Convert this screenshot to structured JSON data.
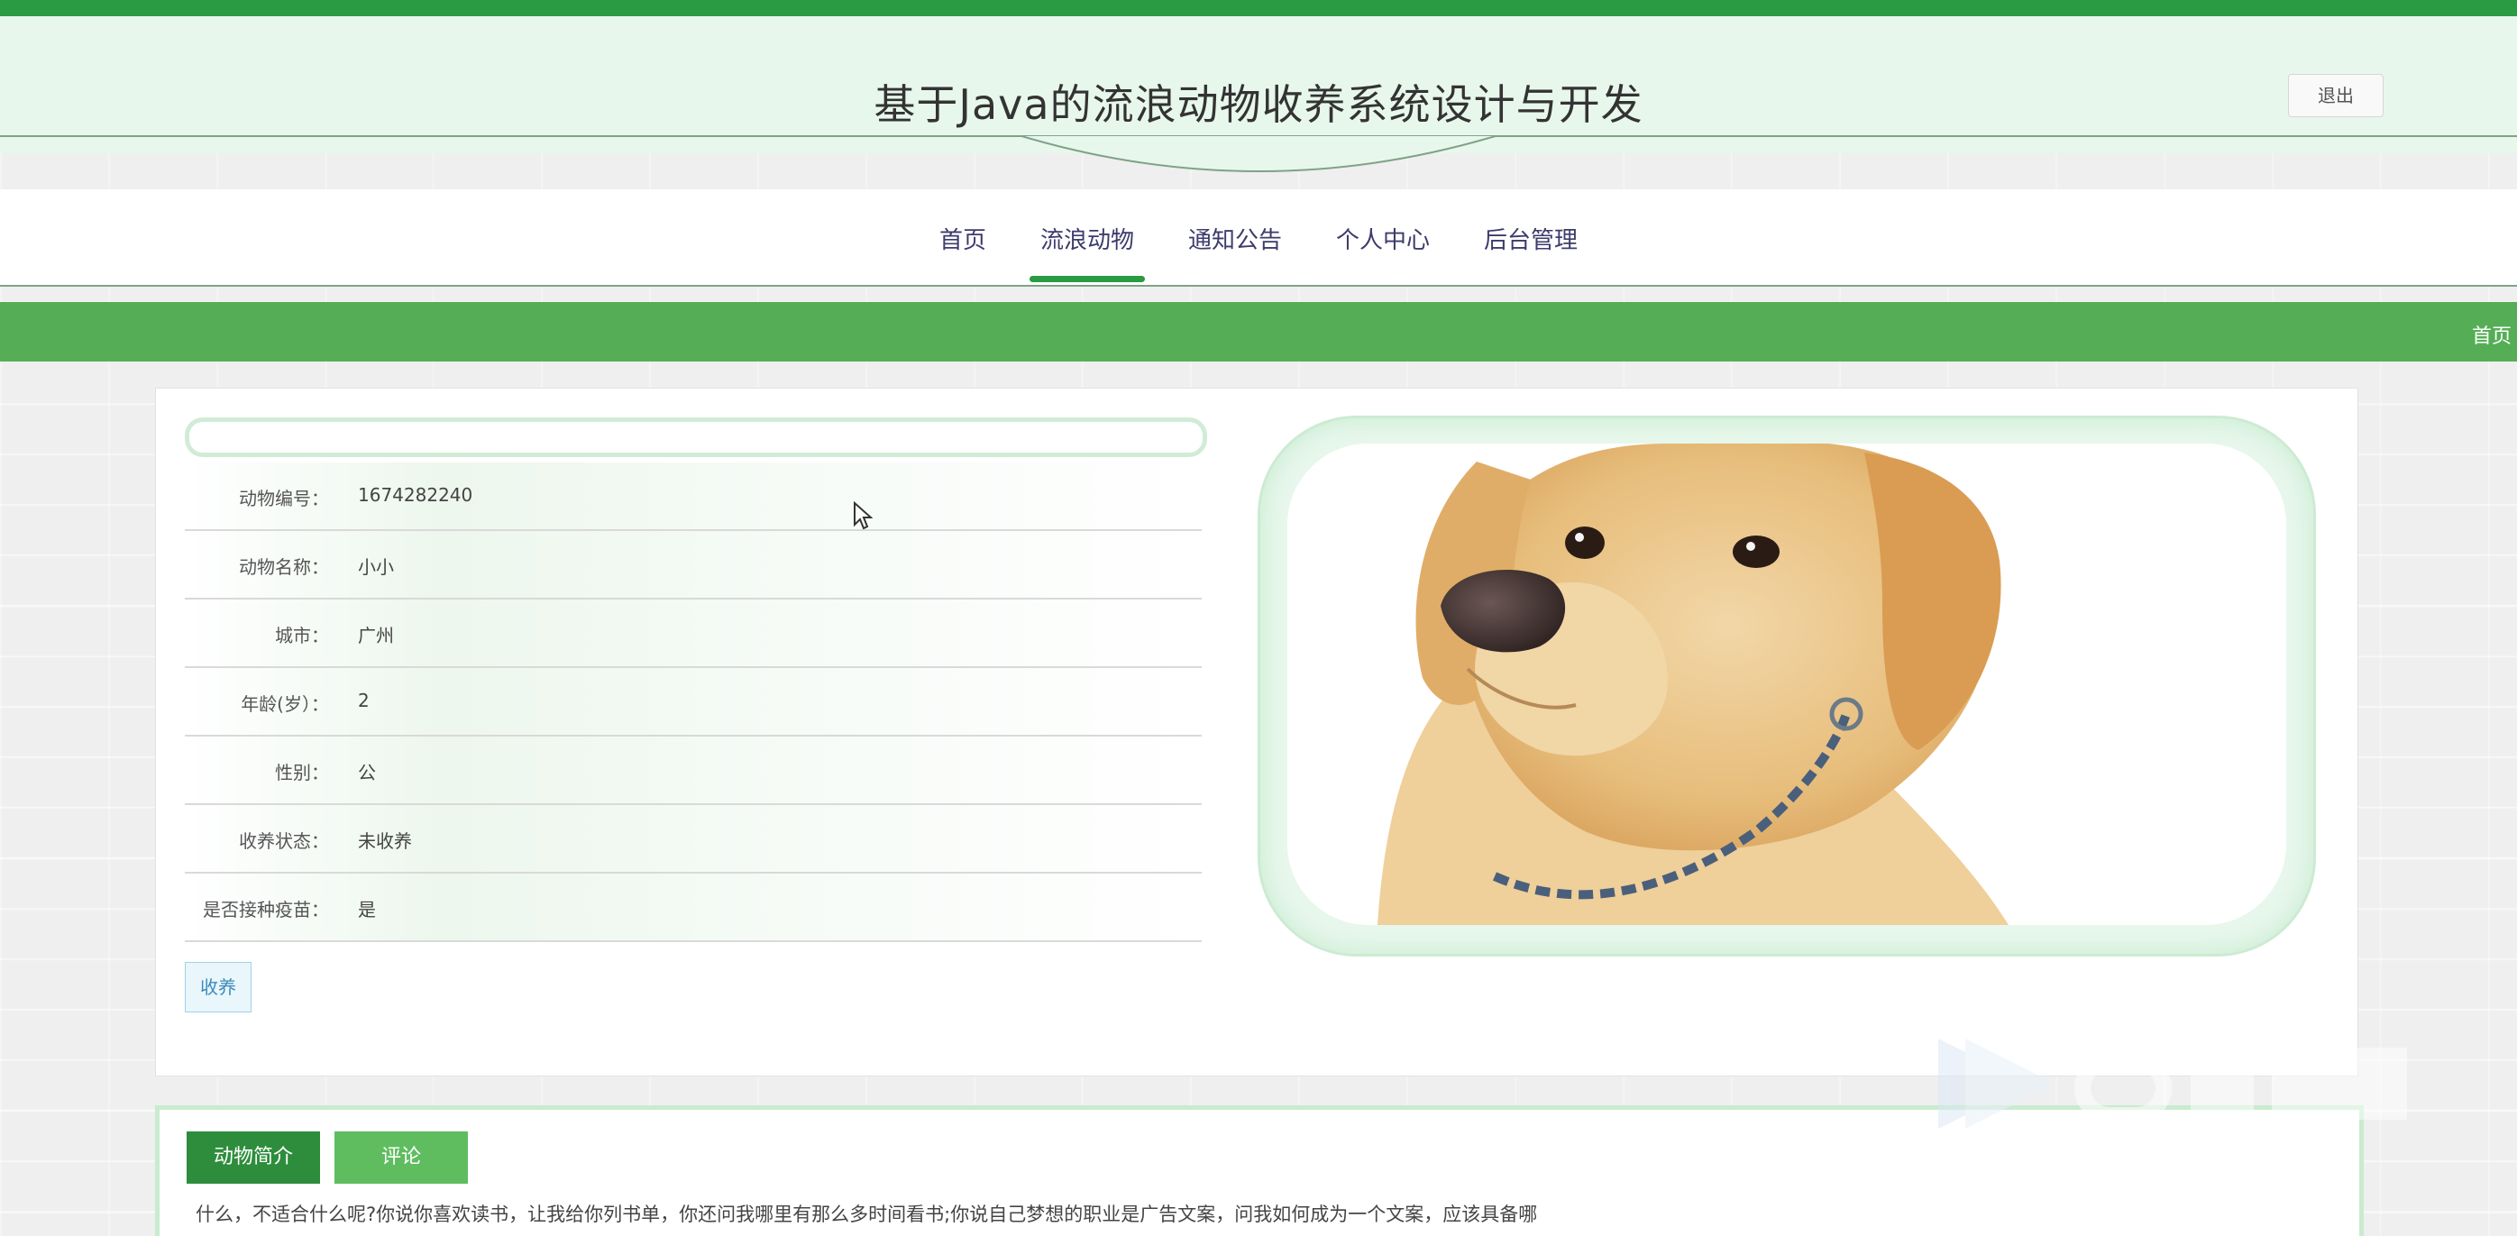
{
  "header": {
    "title": "基于Java的流浪动物收养系统设计与开发",
    "logout_label": "退出"
  },
  "nav": {
    "items": [
      "首页",
      "流浪动物",
      "通知公告",
      "个人中心",
      "后台管理"
    ],
    "active_index": 1
  },
  "breadcrumb": {
    "home": "首页"
  },
  "detail": {
    "fields": [
      {
        "label": "动物编号：",
        "value": "1674282240"
      },
      {
        "label": "动物名称：",
        "value": "小小"
      },
      {
        "label": "城市：",
        "value": "广州"
      },
      {
        "label": "年龄(岁）：",
        "value": "2"
      },
      {
        "label": "性别：",
        "value": "公"
      },
      {
        "label": "收养状态：",
        "value": "未收养"
      },
      {
        "label": "是否接种疫苗：",
        "value": "是"
      }
    ],
    "adopt_label": "收养",
    "image": "dog-photo"
  },
  "tabs": {
    "items": [
      "动物简介",
      "评论"
    ],
    "intro_text": "什么，不适合什么呢?你说你喜欢读书，让我给你列书单，你还问我哪里有那么多时间看书;你说自己梦想的职业是广告文案，问我如何成为一个文案，应该具备哪"
  },
  "colors": {
    "brand_green": "#2a9a43",
    "bar_green": "#55ae55",
    "nav_text": "#3d3b6b"
  }
}
